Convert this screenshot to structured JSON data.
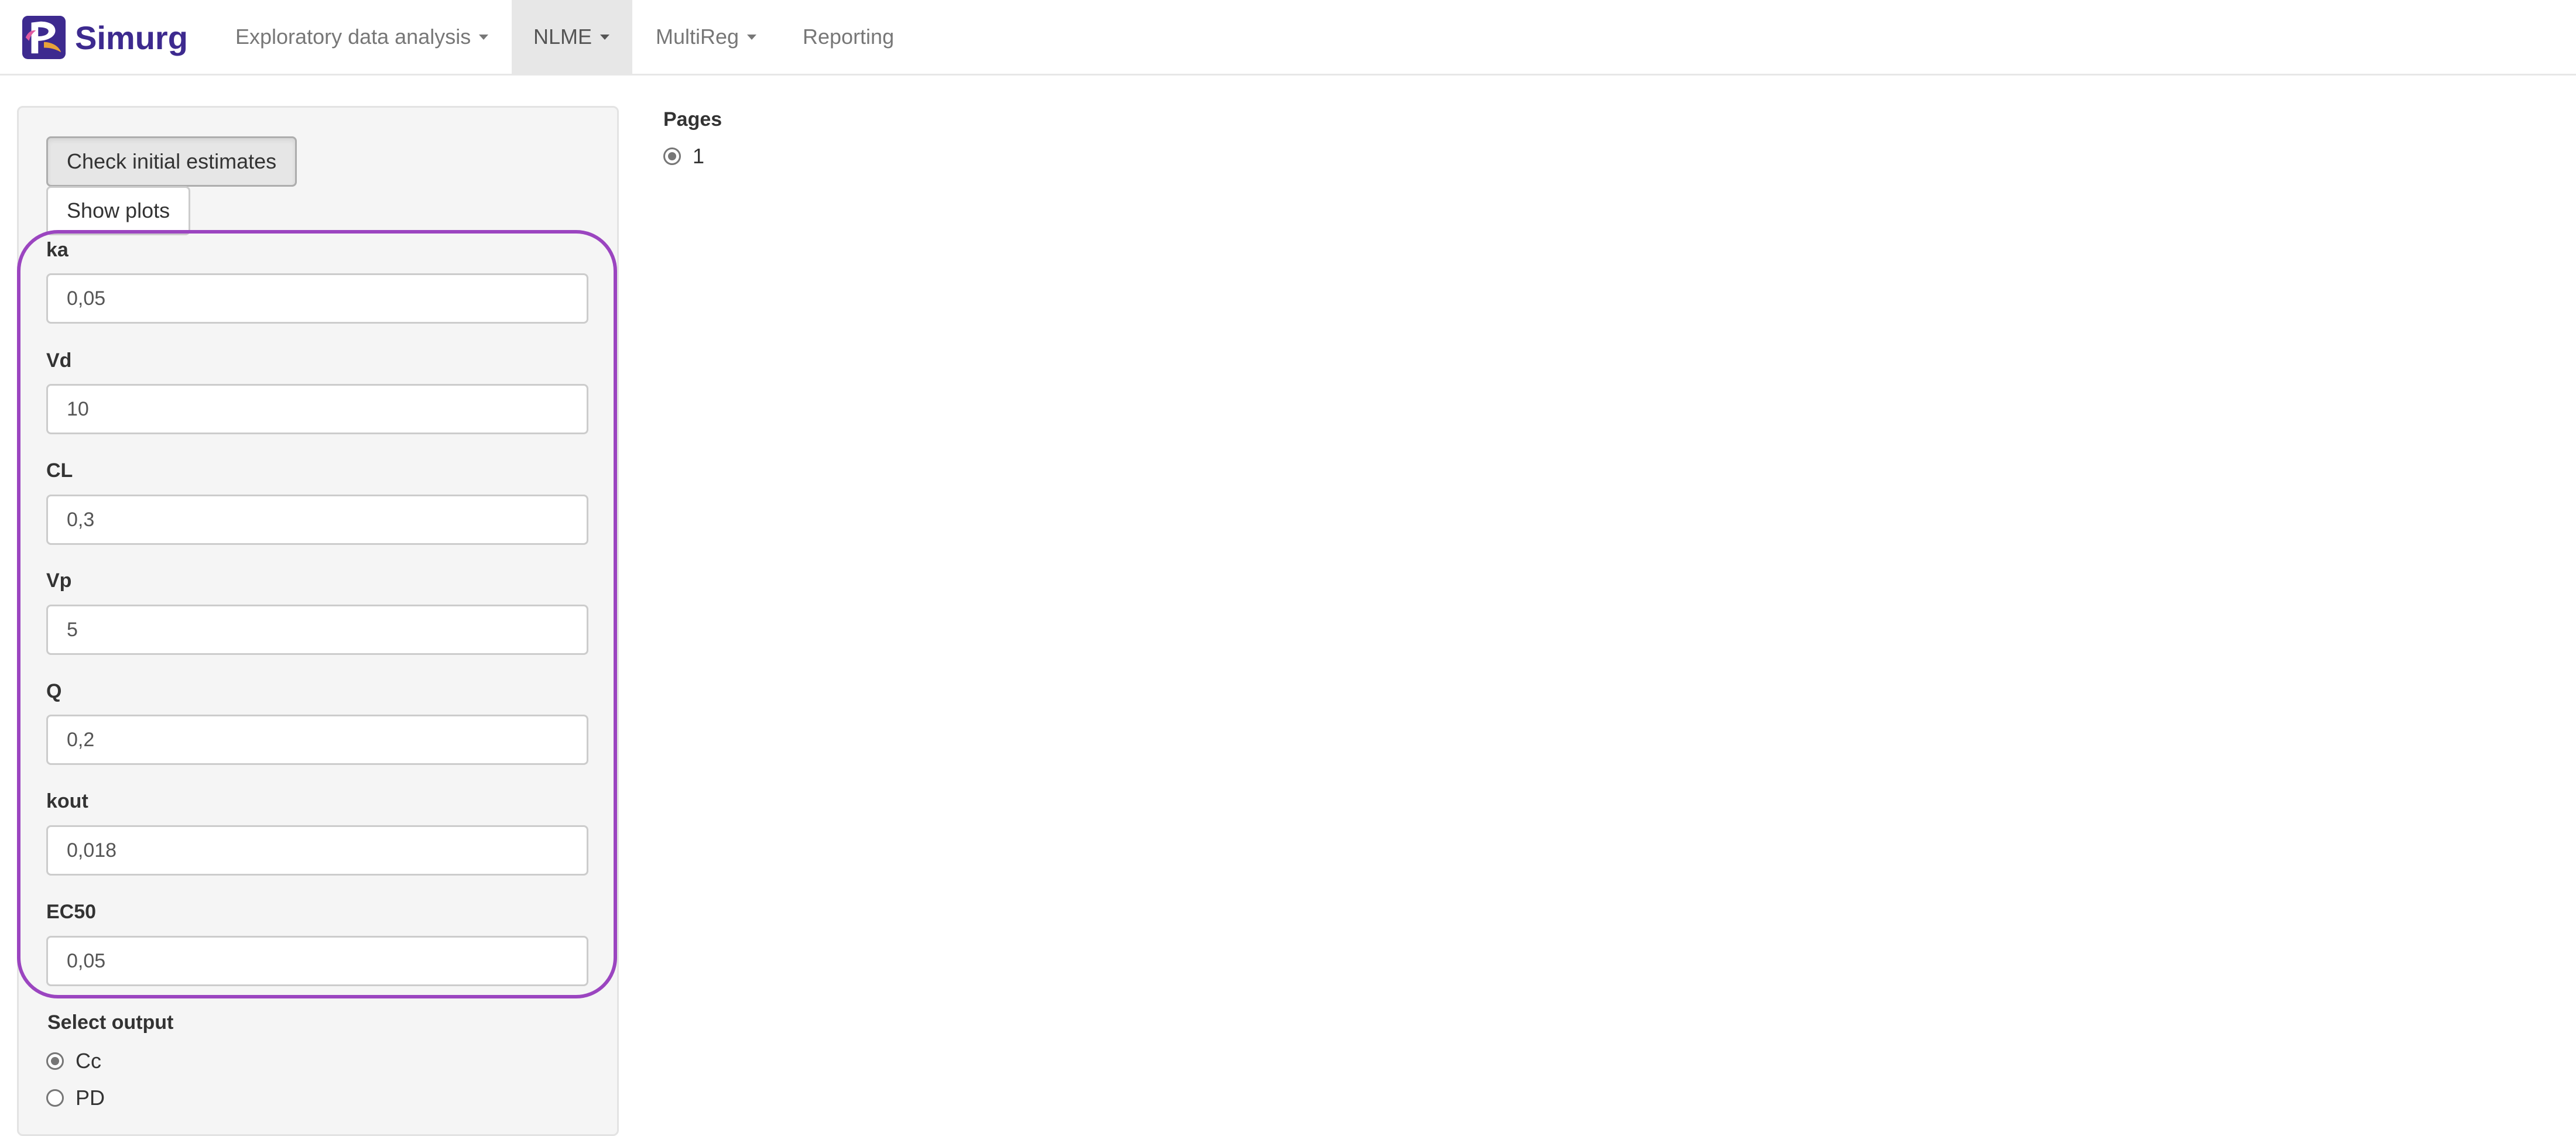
{
  "app": {
    "brand": "Simurg",
    "logo_icon": "simurg-logo-icon",
    "brand_color": "#3d2a8f",
    "highlight_color": "#9b45c0"
  },
  "nav": {
    "items": [
      {
        "label": "Exploratory data analysis",
        "dropdown": true
      },
      {
        "label": "NLME",
        "dropdown": true,
        "active": true
      },
      {
        "label": "MultiReg",
        "dropdown": true
      },
      {
        "label": "Reporting",
        "dropdown": false
      }
    ]
  },
  "sidebar": {
    "check_button": "Check initial estimates",
    "show_plots_button": "Show plots",
    "params": [
      {
        "label": "ka",
        "value": "0,05"
      },
      {
        "label": "Vd",
        "value": "10"
      },
      {
        "label": "CL",
        "value": "0,3"
      },
      {
        "label": "Vp",
        "value": "5"
      },
      {
        "label": "Q",
        "value": "0,2"
      },
      {
        "label": "kout",
        "value": "0,018"
      },
      {
        "label": "EC50",
        "value": "0,05"
      }
    ],
    "output": {
      "label": "Select output",
      "options": [
        {
          "label": "Cc",
          "selected": true
        },
        {
          "label": "PD",
          "selected": false
        }
      ]
    }
  },
  "main": {
    "pages_label": "Pages",
    "pages_options": [
      {
        "label": "1",
        "selected": true
      }
    ]
  }
}
